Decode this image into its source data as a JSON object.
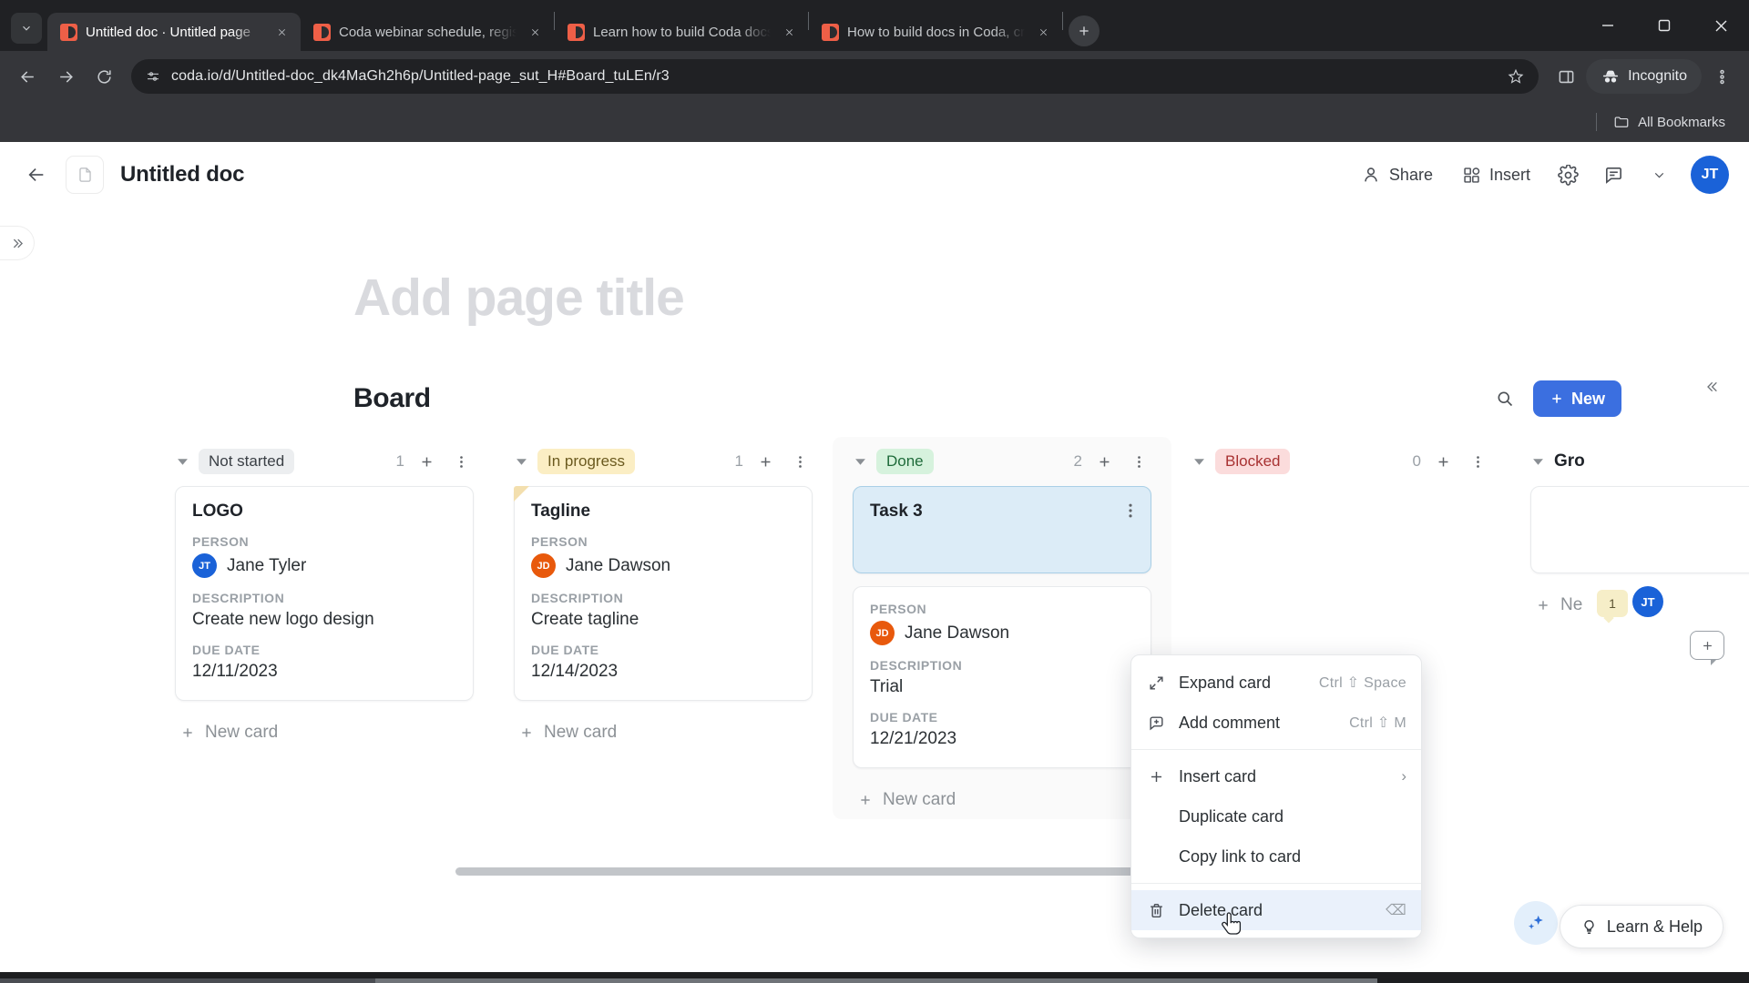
{
  "browser": {
    "tabs": [
      {
        "title": "Untitled doc · Untitled page",
        "active": true
      },
      {
        "title": "Coda webinar schedule, registr",
        "active": false
      },
      {
        "title": "Learn how to build Coda docs",
        "active": false
      },
      {
        "title": "How to build docs in Coda, cre",
        "active": false
      }
    ],
    "url": "coda.io/d/Untitled-doc_dk4MaGh2h6p/Untitled-page_sut_H#Board_tuLEn/r3",
    "profile_label": "Incognito",
    "bookmarks_label": "All Bookmarks"
  },
  "doc": {
    "title": "Untitled doc",
    "page_title_placeholder": "Add page title",
    "header_actions": {
      "share": "Share",
      "insert": "Insert"
    },
    "avatar_initials": "JT"
  },
  "board": {
    "name": "Board",
    "new_button": "New",
    "new_card_label": "New card",
    "columns": [
      {
        "status": "Not started",
        "count": "1",
        "pill_bg": "#eceef0",
        "pill_fg": "#3b4046",
        "shaded": false,
        "cards": [
          {
            "title": "LOGO",
            "person_label": "PERSON",
            "person_name": "Jane Tyler",
            "person_initials": "JT",
            "person_color": "#1a62d8",
            "description_label": "DESCRIPTION",
            "description": "Create new logo design",
            "due_label": "DUE DATE",
            "due_date": "12/11/2023",
            "flag": false,
            "selected": false
          }
        ]
      },
      {
        "status": "In progress",
        "count": "1",
        "pill_bg": "#fbeec4",
        "pill_fg": "#6b5a1f",
        "shaded": false,
        "cards": [
          {
            "title": "Tagline",
            "person_label": "PERSON",
            "person_name": "Jane Dawson",
            "person_initials": "JD",
            "person_color": "#e8590c",
            "description_label": "DESCRIPTION",
            "description": "Create tagline",
            "due_label": "DUE DATE",
            "due_date": "12/14/2023",
            "flag": true,
            "selected": false
          }
        ]
      },
      {
        "status": "Done",
        "count": "2",
        "pill_bg": "#d6f2dd",
        "pill_fg": "#1f6b3a",
        "shaded": true,
        "cards": [
          {
            "title": "Task 3",
            "person_label": "",
            "person_name": "",
            "person_initials": "",
            "person_color": "",
            "description_label": "",
            "description": "",
            "due_label": "",
            "due_date": "",
            "flag": false,
            "selected": true
          },
          {
            "title": "",
            "person_label": "PERSON",
            "person_name": "Jane Dawson",
            "person_initials": "JD",
            "person_color": "#e8590c",
            "description_label": "DESCRIPTION",
            "description": "Trial",
            "due_label": "DUE DATE",
            "due_date": "12/21/2023",
            "flag": false,
            "selected": false
          }
        ]
      },
      {
        "status": "Blocked",
        "count": "0",
        "pill_bg": "#fbdcdc",
        "pill_fg": "#a83232",
        "shaded": false,
        "cards": []
      }
    ],
    "partial_column": {
      "label": "Gro",
      "badge_count": "1",
      "avatar_initials": "JT",
      "new_card_label": "Ne"
    }
  },
  "context_menu": {
    "items": [
      {
        "label": "Expand card",
        "shortcut": "Ctrl ⇧ Space",
        "icon": "expand-icon",
        "kind": "icon"
      },
      {
        "label": "Add comment",
        "shortcut": "Ctrl ⇧ M",
        "icon": "comment-add-icon",
        "kind": "icon"
      },
      {
        "label": "Insert card",
        "shortcut": "",
        "icon": "plus-icon",
        "kind": "submenu"
      },
      {
        "label": "Duplicate card",
        "shortcut": "",
        "icon": "",
        "kind": "plain"
      },
      {
        "label": "Copy link to card",
        "shortcut": "",
        "icon": "",
        "kind": "plain"
      },
      {
        "label": "Delete card",
        "shortcut": "⌫",
        "icon": "trash-icon",
        "kind": "danger"
      }
    ]
  },
  "footer": {
    "help_label": "Learn & Help"
  }
}
